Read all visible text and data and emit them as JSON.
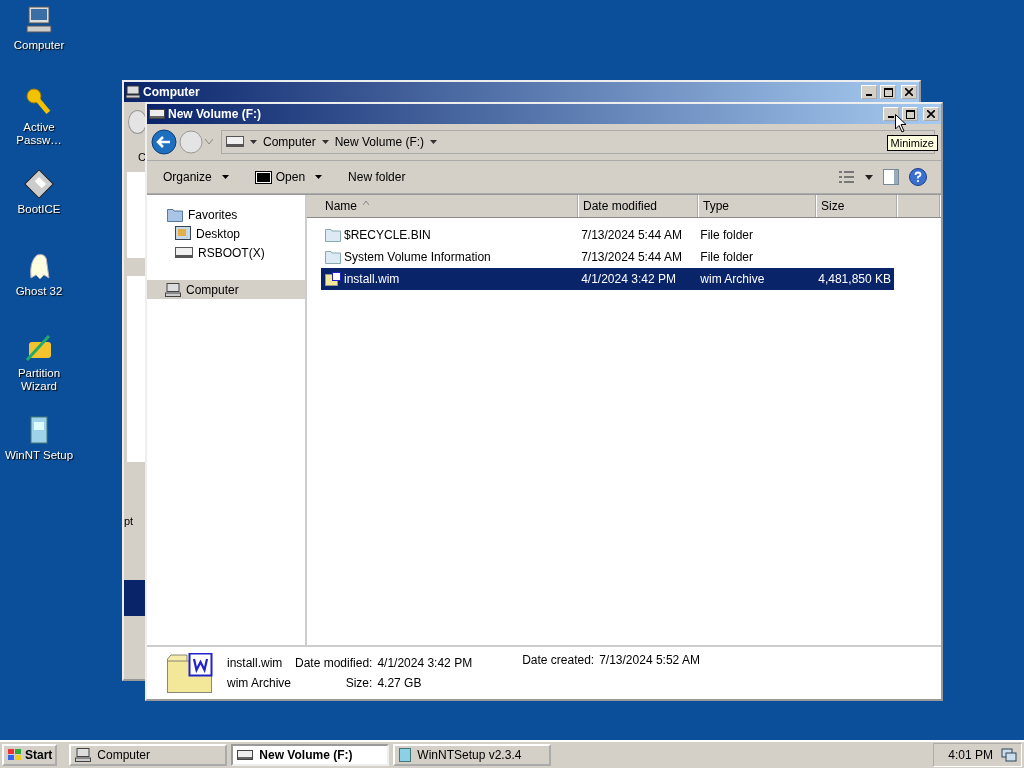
{
  "desktop": {
    "icons": [
      {
        "label": "Computer",
        "kind": "computer"
      },
      {
        "label": "Active Passw…",
        "kind": "key"
      },
      {
        "label": "BootICE",
        "kind": "disk"
      },
      {
        "label": "Ghost 32",
        "kind": "ghost"
      },
      {
        "label": "Partition Wizard",
        "kind": "wizard"
      },
      {
        "label": "WinNT Setup",
        "kind": "setup"
      }
    ]
  },
  "back_window": {
    "title": "Computer",
    "fragments": [
      "C",
      "pt"
    ]
  },
  "window": {
    "title": "New Volume (F:)",
    "tooltip": "Minimize",
    "breadcrumb": [
      "Computer",
      "New Volume (F:)"
    ],
    "toolbar": [
      {
        "label": "Organize",
        "kind": "menu"
      },
      {
        "label": "Open",
        "kind": "open"
      },
      {
        "label": "New folder",
        "kind": "plain"
      }
    ],
    "nav": [
      {
        "label": "Favorites",
        "kind": "favorites",
        "selected": false,
        "children": [
          {
            "label": "Desktop",
            "kind": "desktop",
            "selected": false
          },
          {
            "label": "RSBOOT(X)",
            "kind": "drive",
            "selected": false
          }
        ]
      },
      {
        "label": "Computer",
        "kind": "computer",
        "selected": true
      }
    ],
    "columns": [
      "Name",
      "Date modified",
      "Type",
      "Size"
    ],
    "rows": [
      {
        "name": "$RECYCLE.BIN",
        "date": "7/13/2024 5:44 AM",
        "type": "File folder",
        "size": "",
        "kind": "folder",
        "selected": false
      },
      {
        "name": "System Volume Information",
        "date": "7/13/2024 5:44 AM",
        "type": "File folder",
        "size": "",
        "kind": "folder",
        "selected": false
      },
      {
        "name": "install.wim",
        "date": "4/1/2024 3:42 PM",
        "type": "wim Archive",
        "size": "4,481,850 KB",
        "kind": "archive",
        "selected": true
      }
    ],
    "details": {
      "name": "install.wim",
      "type": "wim Archive",
      "modified_label": "Date modified:",
      "modified": "4/1/2024 3:42 PM",
      "size_label": "Size:",
      "size": "4.27 GB",
      "created_label": "Date created:",
      "created": "7/13/2024 5:52 AM"
    }
  },
  "taskbar": {
    "start": "Start",
    "tasks": [
      {
        "label": "Computer",
        "kind": "computer",
        "selected": false
      },
      {
        "label": "New Volume (F:)",
        "kind": "drive",
        "selected": true
      },
      {
        "label": "WinNTSetup v2.3.4",
        "kind": "setup",
        "selected": false
      }
    ],
    "clock": "4:01 PM"
  }
}
